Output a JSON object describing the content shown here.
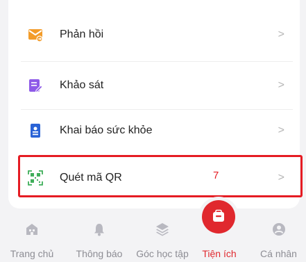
{
  "menu": {
    "items": [
      {
        "label": "Phản hồi",
        "icon": "feedback-icon"
      },
      {
        "label": "Khảo sát",
        "icon": "survey-icon"
      },
      {
        "label": "Khai báo sức khỏe",
        "icon": "health-declaration-icon"
      },
      {
        "label": "Quét mã QR",
        "icon": "qr-scan-icon"
      }
    ],
    "chevron": ">",
    "annotation_marker": "7"
  },
  "tabbar": {
    "tabs": [
      {
        "label": "Trang chủ",
        "icon": "home-icon"
      },
      {
        "label": "Thông báo",
        "icon": "bell-icon"
      },
      {
        "label": "Góc học tập",
        "icon": "layers-icon"
      },
      {
        "label": "Tiện ích",
        "icon": "utilities-icon",
        "active": true
      },
      {
        "label": "Cá nhân",
        "icon": "profile-icon"
      }
    ]
  },
  "colors": {
    "accent": "#e0282e",
    "highlight_border": "#e51c23",
    "feedback_icon": "#f39c2a",
    "survey_icon": "#8e5ae8",
    "health_icon": "#2a63d6",
    "qr_icon": "#3fae5a"
  }
}
